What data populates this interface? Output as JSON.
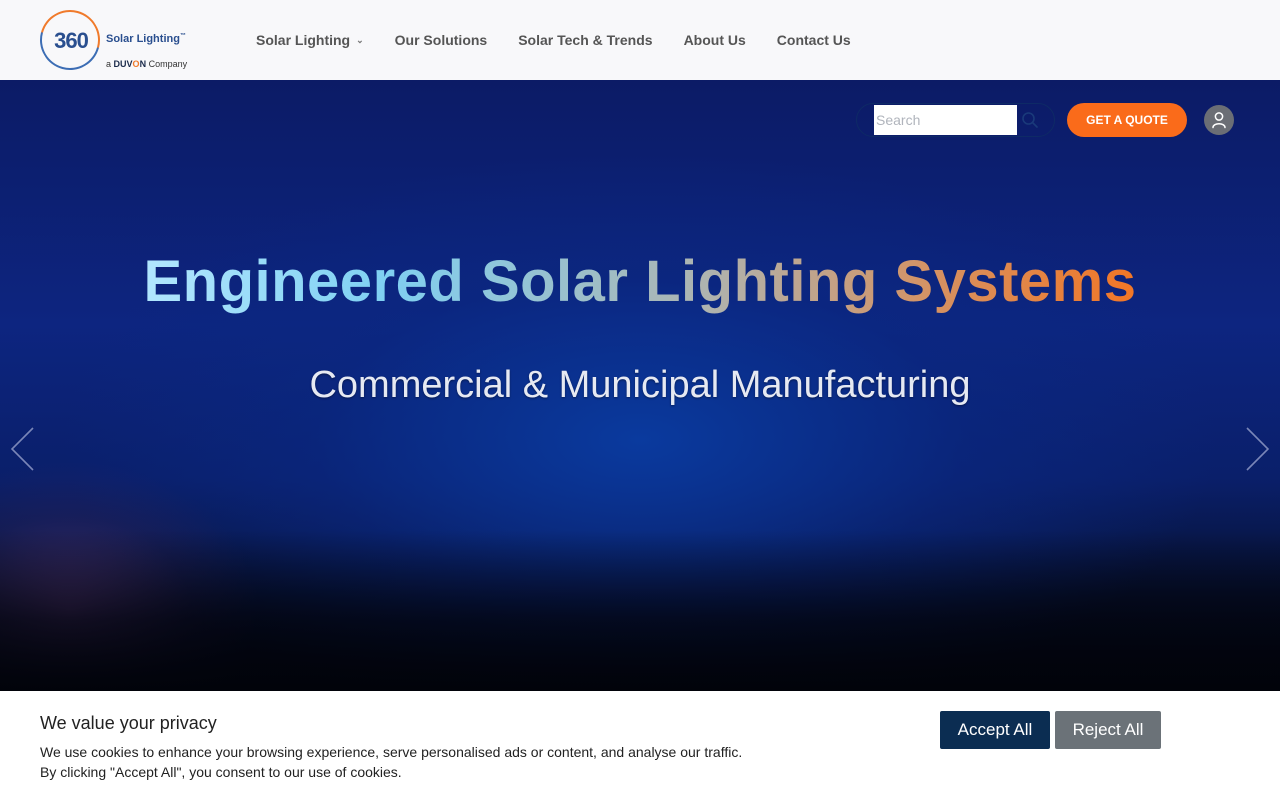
{
  "brand": {
    "logo_number": "360",
    "logo_name": "Solar Lighting",
    "logo_tm": "™",
    "logo_prefix": "a",
    "logo_company_a": "DUV",
    "logo_company_o": "O",
    "logo_company_b": "N",
    "logo_suffix": "Company"
  },
  "nav": {
    "items": [
      {
        "label": "Solar Lighting",
        "has_dropdown": true
      },
      {
        "label": "Our Solutions"
      },
      {
        "label": "Solar Tech & Trends"
      },
      {
        "label": "About Us"
      },
      {
        "label": "Contact Us"
      }
    ]
  },
  "search": {
    "placeholder": "Search",
    "value": ""
  },
  "actions": {
    "quote_label": "GET A QUOTE"
  },
  "hero": {
    "title": "Engineered Solar Lighting Systems",
    "subtitle": "Commercial & Municipal Manufacturing"
  },
  "cookie": {
    "title": "We value your privacy",
    "line1": "We use cookies to enhance your browsing experience, serve personalised ads or content, and analyse our traffic.",
    "line2": "By clicking \"Accept All\", you consent to our use of cookies.",
    "accept_label": "Accept All",
    "reject_label": "Reject All"
  },
  "colors": {
    "accent": "#fa6b1a",
    "brand_blue": "#2a4f8f",
    "accept_bg": "#0b2d52",
    "reject_bg": "#6b7278"
  }
}
